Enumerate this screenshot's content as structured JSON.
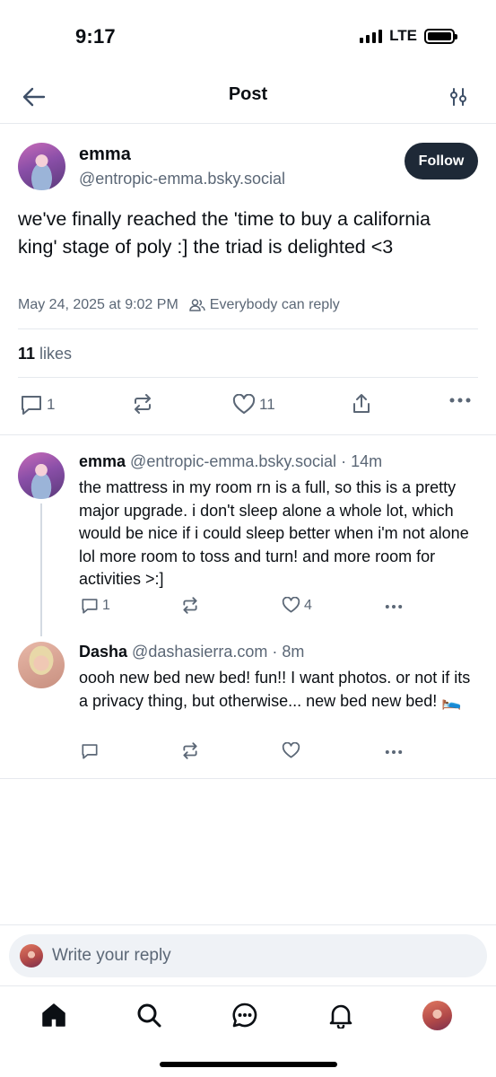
{
  "status_bar": {
    "time": "9:17",
    "network": "LTE"
  },
  "header": {
    "title": "Post"
  },
  "main_post": {
    "author_name": "emma",
    "author_handle": "@entropic-emma.bsky.social",
    "follow_label": "Follow",
    "text": "we've finally reached the 'time to buy a california king' stage of poly :] the triad is delighted <3",
    "timestamp": "May 24, 2025 at 9:02 PM",
    "reply_setting": "Everybody can reply",
    "likes_count": "11",
    "likes_label": "likes",
    "reply_count": "1",
    "like_count": "11"
  },
  "replies": [
    {
      "author_name": "emma",
      "author_handle": "@entropic-emma.bsky.social",
      "time": "· 14m",
      "text": "the mattress in my room rn is a full, so this is a pretty major upgrade. i don't sleep alone a whole lot, which would be nice if i could sleep better when i'm not alone lol more room to toss and turn! and more room for activities >:]",
      "reply_count": "1",
      "like_count": "4"
    },
    {
      "author_name": "Dasha",
      "author_handle": "@dashasierra.com",
      "time": "· 8m",
      "text": "oooh new bed new bed! fun!! I want photos. or not if its a privacy thing, but otherwise... new bed new bed! 🛌",
      "reply_count": "",
      "like_count": ""
    }
  ],
  "composer": {
    "placeholder": "Write your reply"
  },
  "tabs": [
    "home-icon",
    "search-icon",
    "messages-icon",
    "notifications-icon",
    "profile-avatar"
  ],
  "colors": {
    "text": "#0b0f14",
    "muted": "#5b6776",
    "divider": "#e6e9ee",
    "follow_bg": "#1e2937"
  }
}
